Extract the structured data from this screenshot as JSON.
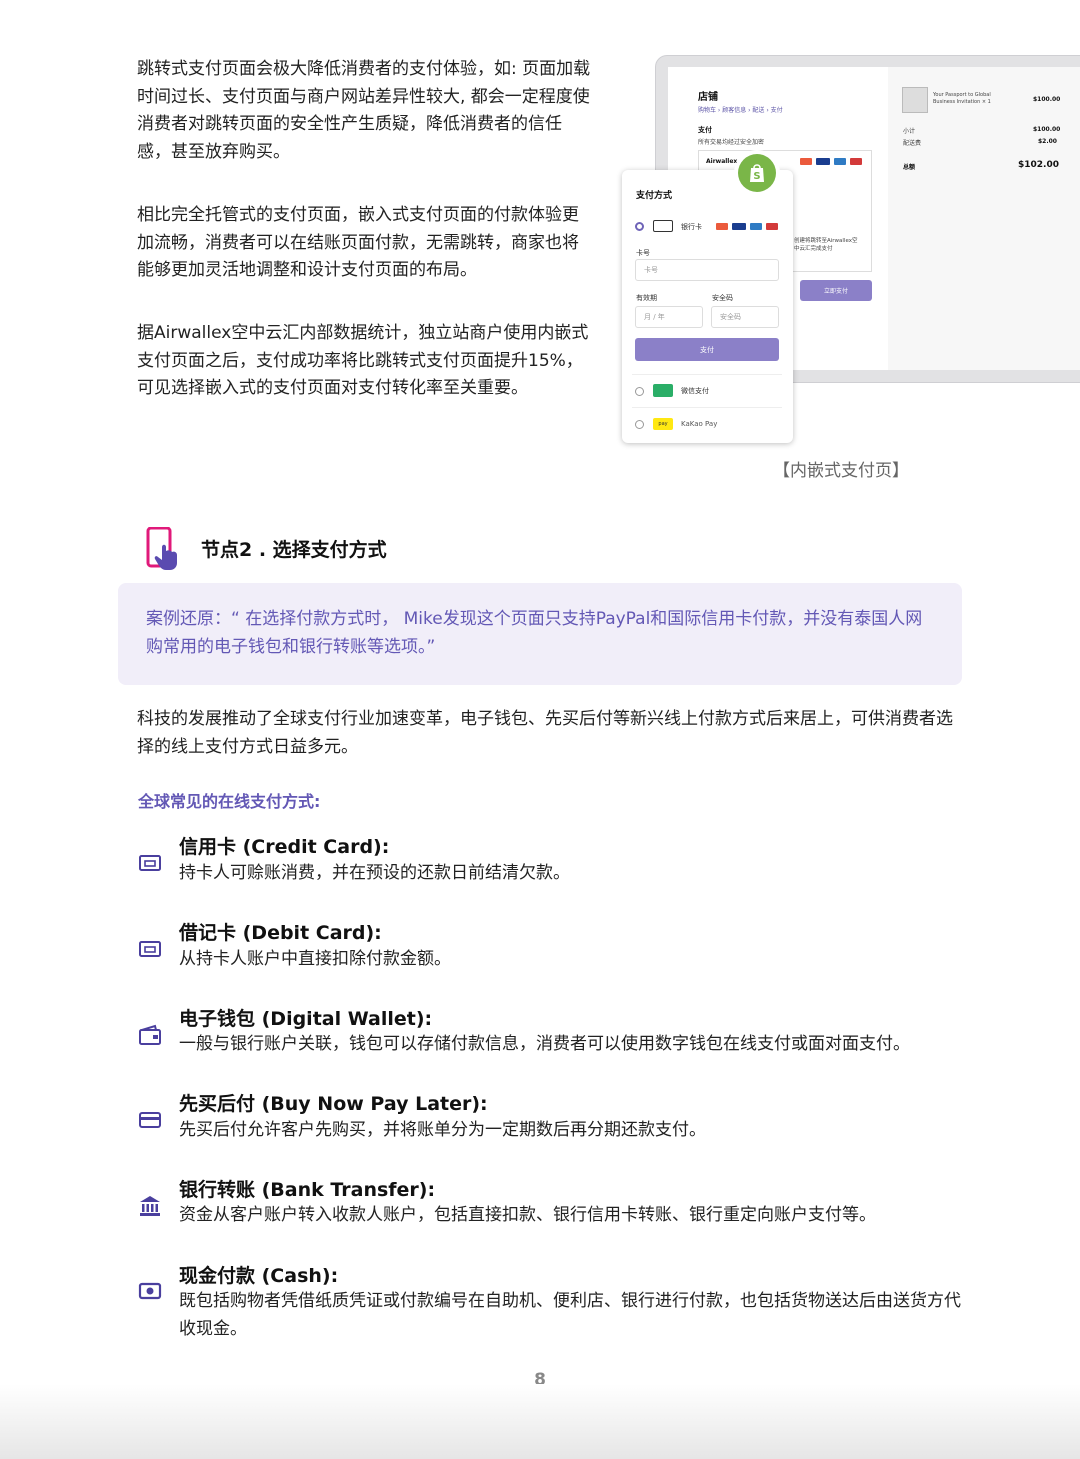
{
  "paragraphs": {
    "p1": "跳转式支付页面会极大降低消费者的支付体验，如: 页面加载时间过长、支付页面与商户网站差异性较大, 都会一定程度使消费者对跳转页面的安全性产生质疑，降低消费者的信任感，甚至放弃购买。",
    "p2": "相比完全托管式的支付页面，嵌入式支付页面的付款体验更加流畅，消费者可以在结账页面付款，无需跳转，商家也将能够更加灵活地调整和设计支付页面的布局。",
    "p3": "据Airwallex空中云汇内部数据统计，独立站商户使用内嵌式支付页面之后，支付成功率将比跳转式支付页面提升15%，可见选择嵌入式的支付页面对支付转化率至关重要。"
  },
  "mockup": {
    "store_title": "店铺",
    "breadcrumb": "购物车 › 顾客信息 › 配送 › 支付",
    "pay_heading": "支付",
    "pay_sub": "所有交易均经过安全加密",
    "airwallex": "Airwallex",
    "redirect_note_1": "创建将跳转至Airwallex空",
    "redirect_note_2": "中云汇完成支付",
    "pay_now": "立即支付",
    "order_item": "Your Passport to Global Business Invitation × 1",
    "item_price": "$100.00",
    "subtotal_label": "小计",
    "subtotal_value": "$100.00",
    "shipping_label": "配送费",
    "shipping_value": "$2.00",
    "total_label": "总额",
    "total_value": "$102.00",
    "modal_title": "支付方式",
    "bank_card": "银行卡",
    "card_number_label": "卡号",
    "card_number_placeholder": "卡号",
    "expiry_label": "有效期",
    "expiry_placeholder": "月 / 年",
    "cvc_label": "安全码",
    "cvc_placeholder": "安全码",
    "pay_button": "支付",
    "wechat_pay": "微信支付",
    "kakao_pay": "KaKao Pay",
    "kakao_badge": "pay"
  },
  "caption": "【内嵌式支付页】",
  "section": {
    "title": "节点2 . 选择支付方式",
    "case": "案例还原：“ 在选择付款方式时， Mike发现这个页面只支持PayPal和国际信用卡付款，并没有泰国人网购常用的电子钱包和银行转账等选项。”",
    "intro": "科技的发展推动了全球支付行业加速变革，电子钱包、先买后付等新兴线上付款方式后来居上，可供消费者选择的线上支付方式日益多元。",
    "subheading": "全球常见的在线支付方式:"
  },
  "methods": [
    {
      "title": "信用卡 (Credit Card):",
      "desc": "持卡人可赊账消费，并在预设的还款日前结清欠款。",
      "icon": "credit-card-icon"
    },
    {
      "title": "借记卡 (Debit Card):",
      "desc": "从持卡人账户中直接扣除付款金额。",
      "icon": "debit-card-icon"
    },
    {
      "title": "电子钱包 (Digital Wallet):",
      "desc": "一般与银行账户关联，钱包可以存储付款信息，消费者可以使用数字钱包在线支付或面对面支付。",
      "icon": "wallet-icon"
    },
    {
      "title": "先买后付 (Buy Now Pay Later):",
      "desc": "先买后付允许客户先购买，并将账单分为一定期数后再分期还款支付。",
      "icon": "card-icon"
    },
    {
      "title": "银行转账 (Bank Transfer):",
      "desc": "资金从客户账户转入收款人账户，包括直接扣款、银行信用卡转账、银行重定向账户支付等。",
      "icon": "bank-icon"
    },
    {
      "title": "现金付款 (Cash):",
      "desc": "既包括购物者凭借纸质凭证或付款编号在自助机、便利店、银行进行付款，也包括货物送达后由送货方代收现金。",
      "icon": "cash-icon"
    }
  ],
  "page_number": "8",
  "colors": {
    "accent": "#6358b5",
    "case_bg": "#f1eef9",
    "button": "#8b80c8",
    "shopify": "#7ab648"
  }
}
